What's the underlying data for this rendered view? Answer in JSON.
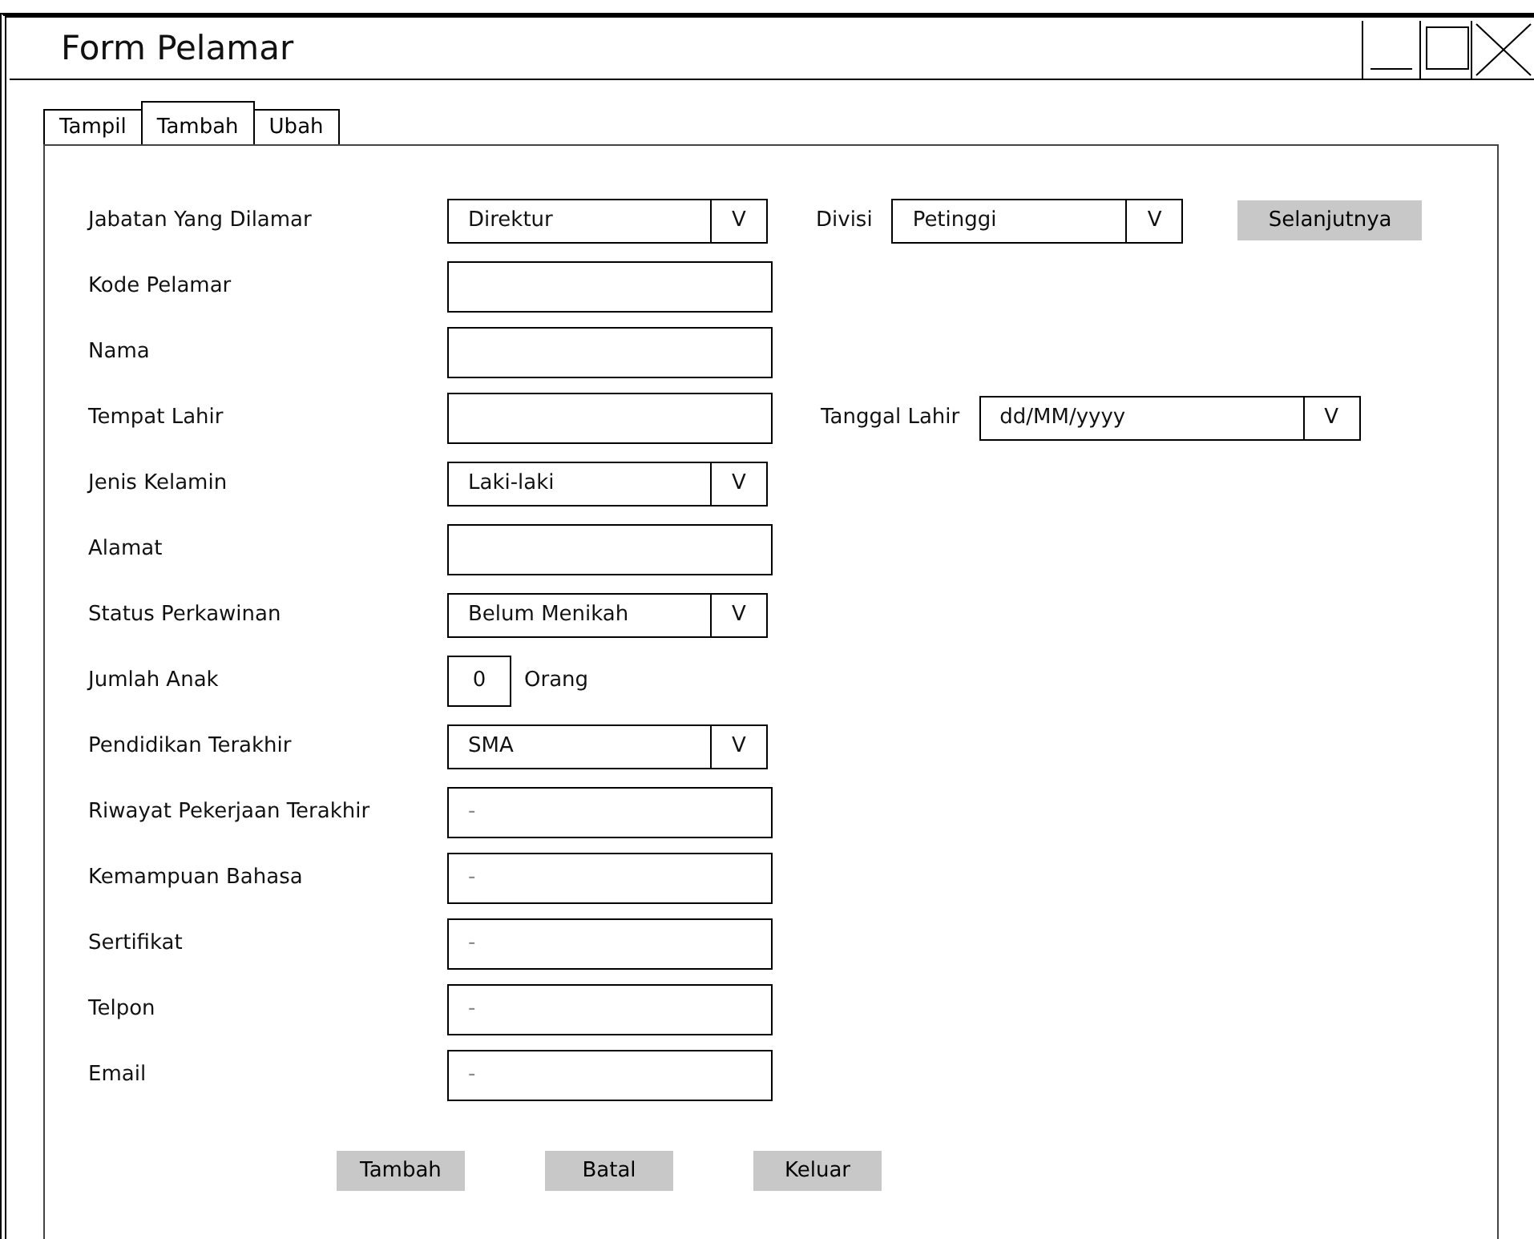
{
  "window": {
    "title": "Form Pelamar"
  },
  "tabs": [
    {
      "label": "Tampil",
      "selected": false
    },
    {
      "label": "Tambah",
      "selected": true
    },
    {
      "label": "Ubah",
      "selected": false
    }
  ],
  "form": {
    "rows": [
      {
        "label": "Jabatan Yang Dilamar",
        "kind": "dropdown",
        "value": "Direktur",
        "arrow": "V",
        "side": {
          "label": "Divisi",
          "kind": "dropdown",
          "value": "Petinggi",
          "arrow": "V",
          "button": "Selanjutnya"
        }
      },
      {
        "label": "Kode Pelamar",
        "kind": "text"
      },
      {
        "label": "Nama",
        "kind": "text"
      },
      {
        "label": "Tempat Lahir",
        "kind": "text",
        "side": {
          "label": "Tanggal Lahir",
          "kind": "date",
          "value": "dd/MM/yyyy",
          "arrow": "V"
        }
      },
      {
        "label": "Jenis Kelamin",
        "kind": "dropdown",
        "value": "Laki-laki",
        "arrow": "V"
      },
      {
        "label": "Alamat",
        "kind": "text"
      },
      {
        "label": "Status Perkawinan",
        "kind": "dropdown",
        "value": "Belum Menikah",
        "arrow": "V"
      },
      {
        "label": "Jumlah Anak",
        "kind": "number",
        "value": "0",
        "unit": "Orang"
      },
      {
        "label": "Pendidikan Terakhir",
        "kind": "dropdown",
        "value": "SMA",
        "arrow": "V"
      },
      {
        "label": "Riwayat Pekerjaan Terakhir",
        "kind": "text",
        "value": "-"
      },
      {
        "label": "Kemampuan Bahasa",
        "kind": "text",
        "value": "-"
      },
      {
        "label": "Sertifikat",
        "kind": "text",
        "value": "-"
      },
      {
        "label": "Telpon",
        "kind": "text",
        "value": "-"
      },
      {
        "label": "Email",
        "kind": "text",
        "value": "-"
      }
    ]
  },
  "buttons": [
    "Tambah",
    "Batal",
    "Keluar"
  ]
}
